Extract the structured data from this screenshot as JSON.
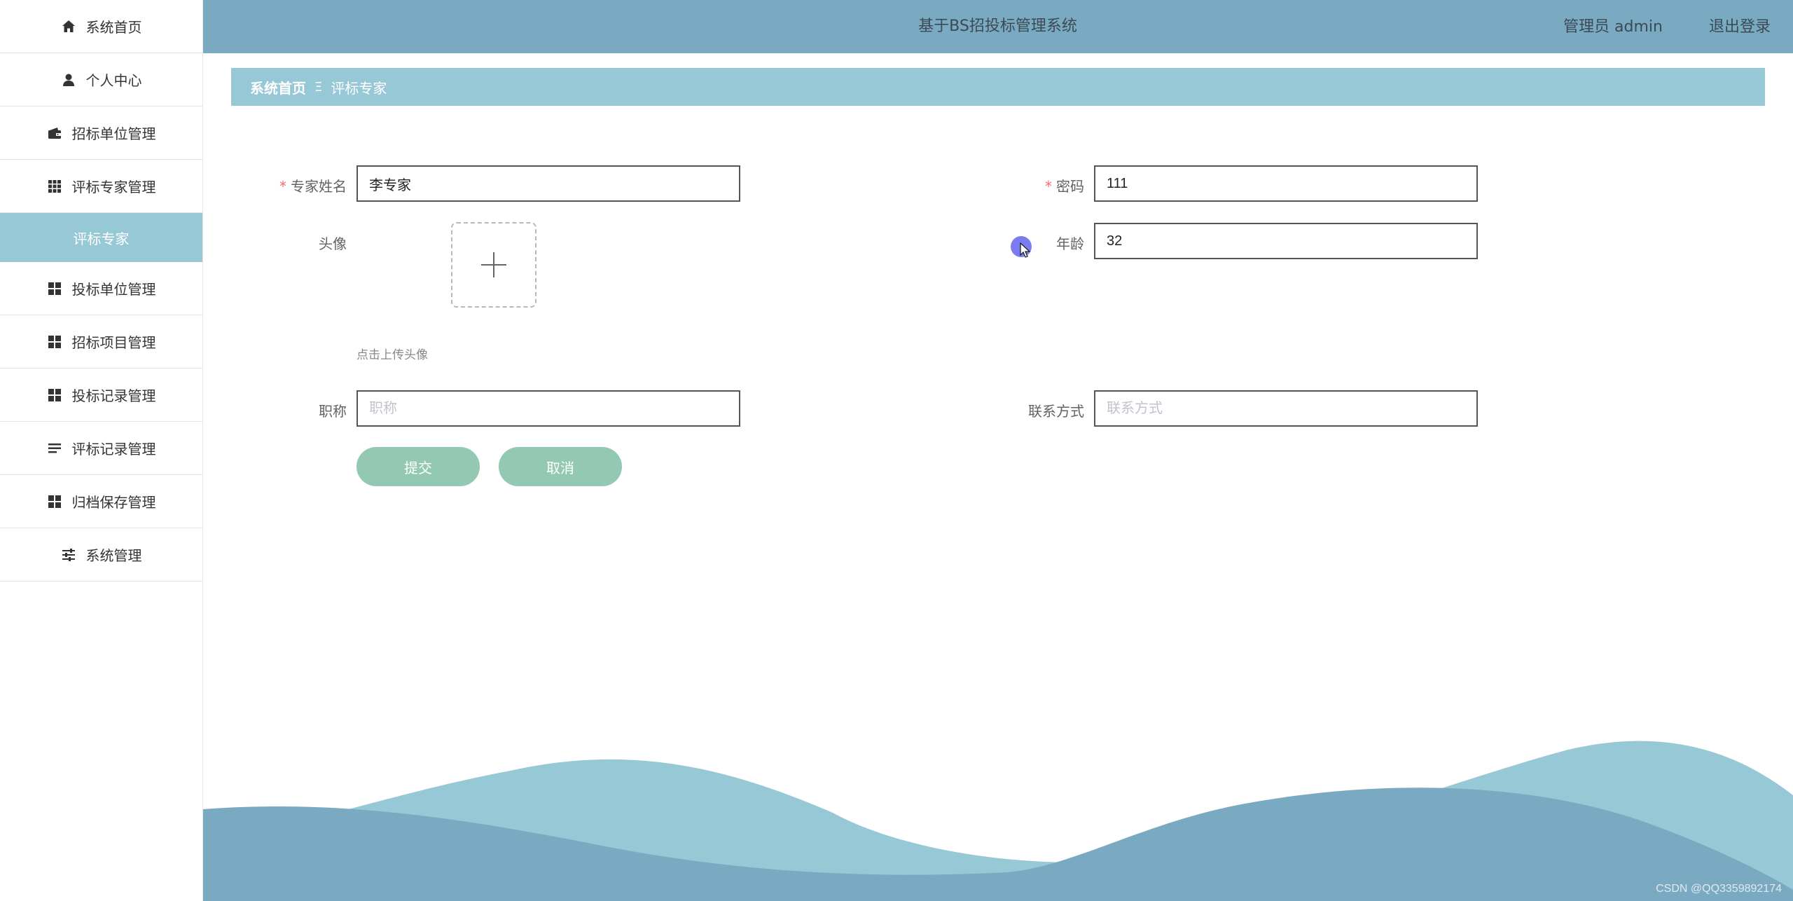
{
  "header": {
    "title": "基于BS招投标管理系统",
    "user_label": "管理员 admin",
    "logout_label": "退出登录"
  },
  "sidebar": {
    "items": [
      {
        "label": "系统首页",
        "icon": "home-icon"
      },
      {
        "label": "个人中心",
        "icon": "user-icon"
      },
      {
        "label": "招标单位管理",
        "icon": "wallet-icon"
      },
      {
        "label": "评标专家管理",
        "icon": "grid-icon"
      },
      {
        "label": "评标专家",
        "icon": ""
      },
      {
        "label": "投标单位管理",
        "icon": "tiles-icon"
      },
      {
        "label": "招标项目管理",
        "icon": "tiles-icon"
      },
      {
        "label": "投标记录管理",
        "icon": "tiles-icon"
      },
      {
        "label": "评标记录管理",
        "icon": "list-icon"
      },
      {
        "label": "归档保存管理",
        "icon": "tiles-icon"
      },
      {
        "label": "系统管理",
        "icon": "sliders-icon"
      }
    ]
  },
  "breadcrumb": {
    "home": "系统首页",
    "separator": "Ξ",
    "current": "评标专家"
  },
  "form": {
    "name_label": "专家姓名",
    "name_value": "李专家",
    "password_label": "密码",
    "password_value": "111",
    "avatar_label": "头像",
    "avatar_tip": "点击上传头像",
    "age_label": "年龄",
    "age_value": "32",
    "title_label": "职称",
    "title_placeholder": "职称",
    "contact_label": "联系方式",
    "contact_placeholder": "联系方式",
    "required_mark": "*",
    "submit_label": "提交",
    "cancel_label": "取消"
  },
  "colors": {
    "topbar": "#7aaac2",
    "breadcrumb": "#97c8d6",
    "button": "#93c8b3",
    "required": "#f56c6c"
  },
  "watermark": "CSDN @QQ3359892174"
}
